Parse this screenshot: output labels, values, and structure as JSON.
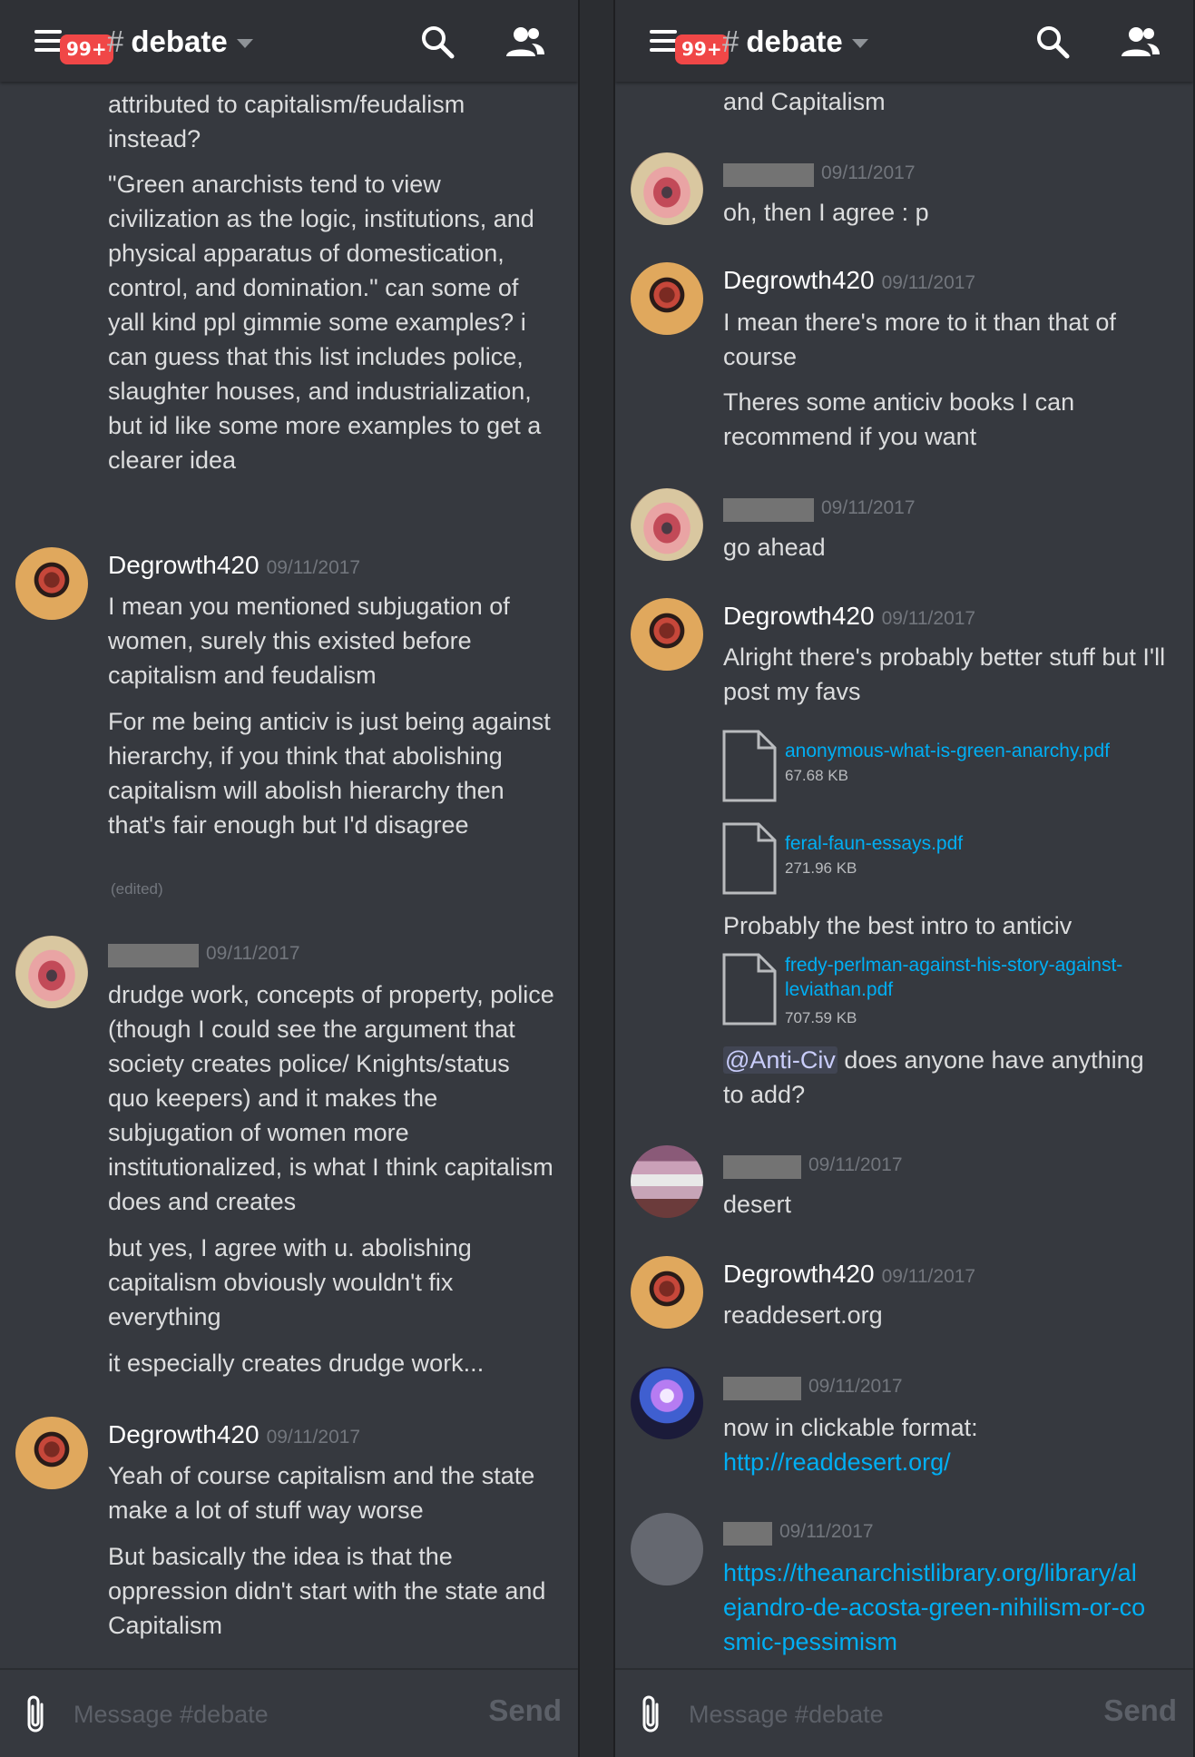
{
  "channel": {
    "name": "debate",
    "unread_badge": "99+"
  },
  "composer": {
    "placeholder": "Message #debate",
    "send_label": "Send"
  },
  "left": {
    "top_text": "attributed to capitalism/feudalism instead?",
    "top_text2": "\"Green anarchists tend to view civilization as the logic, institutions, and physical apparatus of domestication, control, and domination.\" can some of yall kind ppl gimmie some examples? i can guess that this list includes police, slaughter houses, and industrialization, but id like some more examples to get a clearer idea",
    "msg1": {
      "author": "Degrowth420",
      "time": "09/11/2017",
      "p1": "I mean you mentioned subjugation of women, surely this existed before capitalism and feudalism",
      "p2": "For me being anticiv is just being against hierarchy, if you think that abolishing capitalism will abolish hierarchy then that's fair enough but I'd disagree",
      "edited": "(edited)"
    },
    "msg2": {
      "time": "09/11/2017",
      "p1": "drudge work, concepts of property, police (though I could see the argument that society creates police/ Knights/status quo keepers) and it makes the subjugation of women more institutionalized, is what I think capitalism does and creates",
      "p2": "but yes, I agree with u. abolishing capitalism obviously wouldn't fix everything",
      "p3": "it especially creates drudge work..."
    },
    "msg3": {
      "author": "Degrowth420",
      "time": "09/11/2017",
      "p1": "Yeah of course capitalism and the state make a lot of stuff way worse",
      "p2": "But basically the idea is that the oppression didn't start with the state and Capitalism"
    }
  },
  "right": {
    "top_text": "and Capitalism",
    "msg1": {
      "time": "09/11/2017",
      "p1": "oh, then I agree : p"
    },
    "msg2": {
      "author": "Degrowth420",
      "time": "09/11/2017",
      "p1": "I mean there's more to it than that of course",
      "p2": "Theres some anticiv books I can recommend if you want"
    },
    "msg3": {
      "time": "09/11/2017",
      "p1": "go ahead"
    },
    "msg4": {
      "author": "Degrowth420",
      "time": "09/11/2017",
      "p1": "Alright there's probably better stuff but I'll post my favs",
      "files": [
        {
          "name": "anonymous-what-is-green-anarchy.pdf",
          "size": "67.68 KB"
        },
        {
          "name": "feral-faun-essays.pdf",
          "size": "271.96 KB"
        },
        {
          "name": "fredy-perlman-against-his-story-against-leviathan.pdf",
          "size": "707.59 KB"
        }
      ],
      "between": "Probably the best intro to anticiv",
      "mention": "@Anti-Civ",
      "after_mention": " does anyone have anything to add?"
    },
    "msg5": {
      "time": "09/11/2017",
      "p1": "desert"
    },
    "msg6": {
      "author": "Degrowth420",
      "time": "09/11/2017",
      "p1": "readdesert.org"
    },
    "msg7": {
      "time": "09/11/2017",
      "p1": "now in clickable format: ",
      "link": "http://readdesert.org/"
    },
    "msg8": {
      "time": "09/11/2017",
      "link": "https://theanarchistlibrary.org/library/alejandro-de-acosta-green-nihilism-or-cosmic-pessimism"
    }
  }
}
